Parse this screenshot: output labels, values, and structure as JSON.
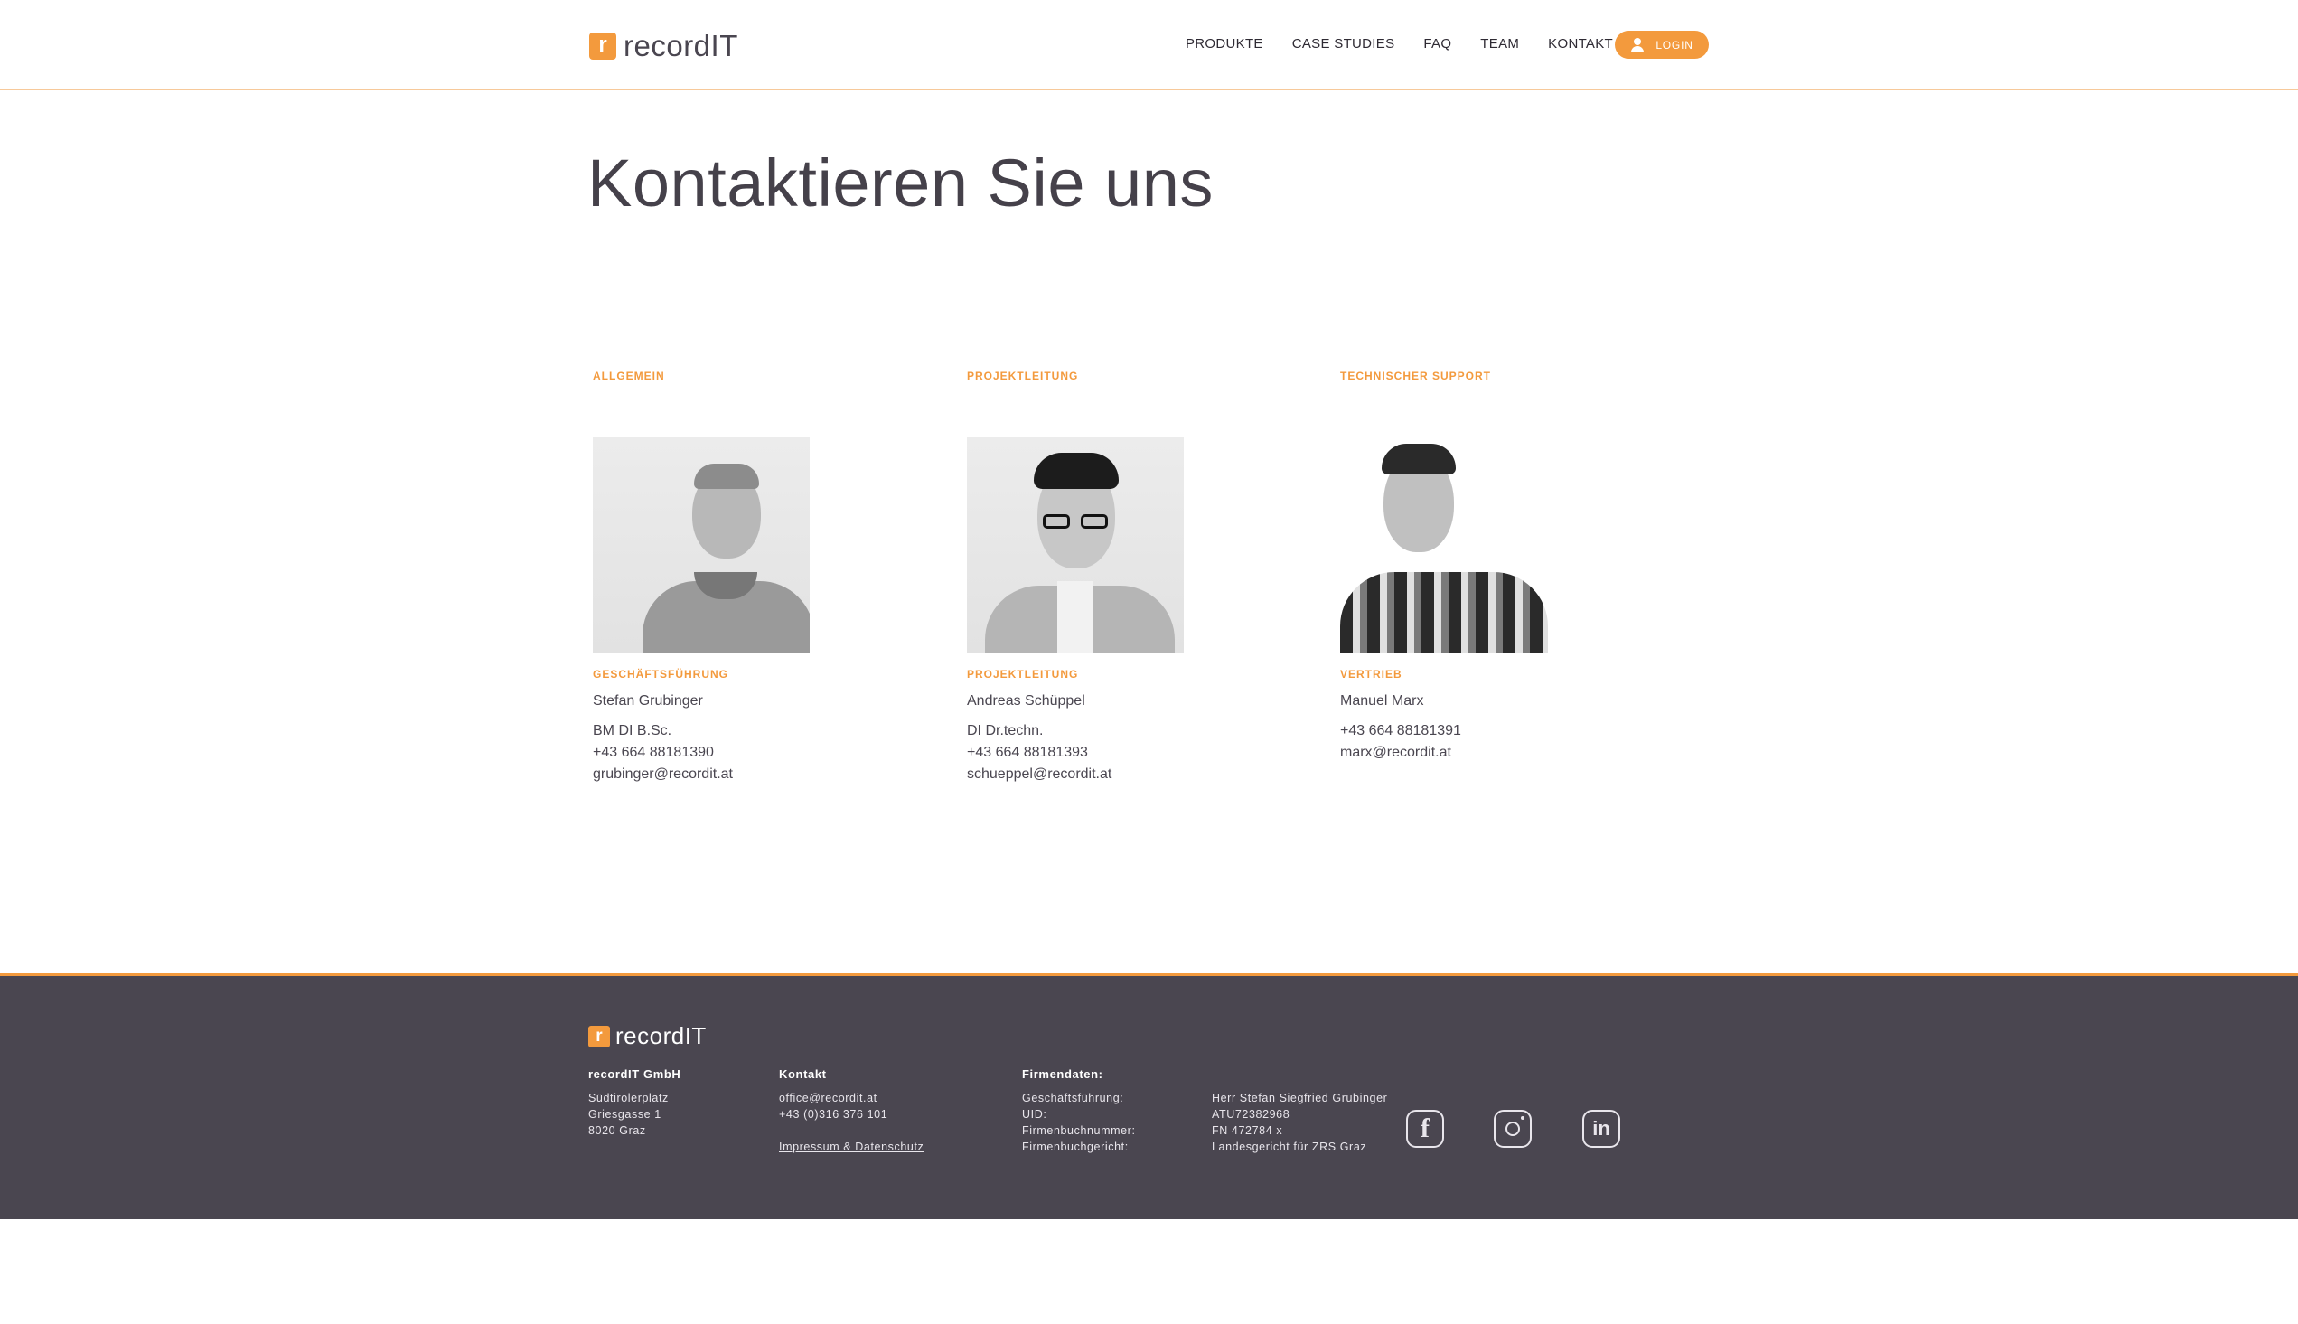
{
  "brand": {
    "logo_letter": "r",
    "name": "recordIT",
    "accent": "#f39a3d",
    "footer_bg": "#4a4650"
  },
  "nav": {
    "items": [
      "PRODUKTE",
      "CASE STUDIES",
      "FAQ",
      "TEAM",
      "KONTAKT"
    ],
    "login": "LOGIN"
  },
  "main": {
    "title": "Kontaktieren Sie uns",
    "contacts": [
      {
        "category": "ALLGEMEIN",
        "role": "GESCHÄFTSFÜHRUNG",
        "name": "Stefan Grubinger",
        "degree": "BM DI B.Sc.",
        "phone": "+43 664 88181390",
        "email": "grubinger@recordit.at"
      },
      {
        "category": "PROJEKTLEITUNG",
        "role": "PROJEKTLEITUNG",
        "name": "Andreas Schüppel",
        "degree": "DI Dr.techn.",
        "phone": "+43 664 88181393",
        "email": "schueppel@recordit.at"
      },
      {
        "category": "TECHNISCHER SUPPORT",
        "role": "VERTRIEB",
        "name": "Manuel Marx",
        "phone": "+43 664 88181391",
        "email": "marx@recordit.at"
      }
    ]
  },
  "footer": {
    "company": {
      "title": "recordIT GmbH",
      "lines": [
        "Südtirolerplatz",
        "Griesgasse 1",
        "8020 Graz"
      ]
    },
    "contact": {
      "title": "Kontakt",
      "email": "office@recordit.at",
      "phone": "+43 (0)316 376 101",
      "legal_link": "Impressum & Datenschutz"
    },
    "firm": {
      "title": "Firmendaten:",
      "labels": [
        "Geschäftsführung:",
        "UID:",
        "Firmenbuchnummer:",
        "Firmenbuchgericht:"
      ],
      "values": [
        "Herr Stefan Siegfried Grubinger",
        "ATU72382968",
        "FN 472784 x",
        "Landesgericht für ZRS Graz"
      ]
    },
    "social": [
      "facebook-icon",
      "instagram-icon",
      "linkedin-icon"
    ]
  }
}
